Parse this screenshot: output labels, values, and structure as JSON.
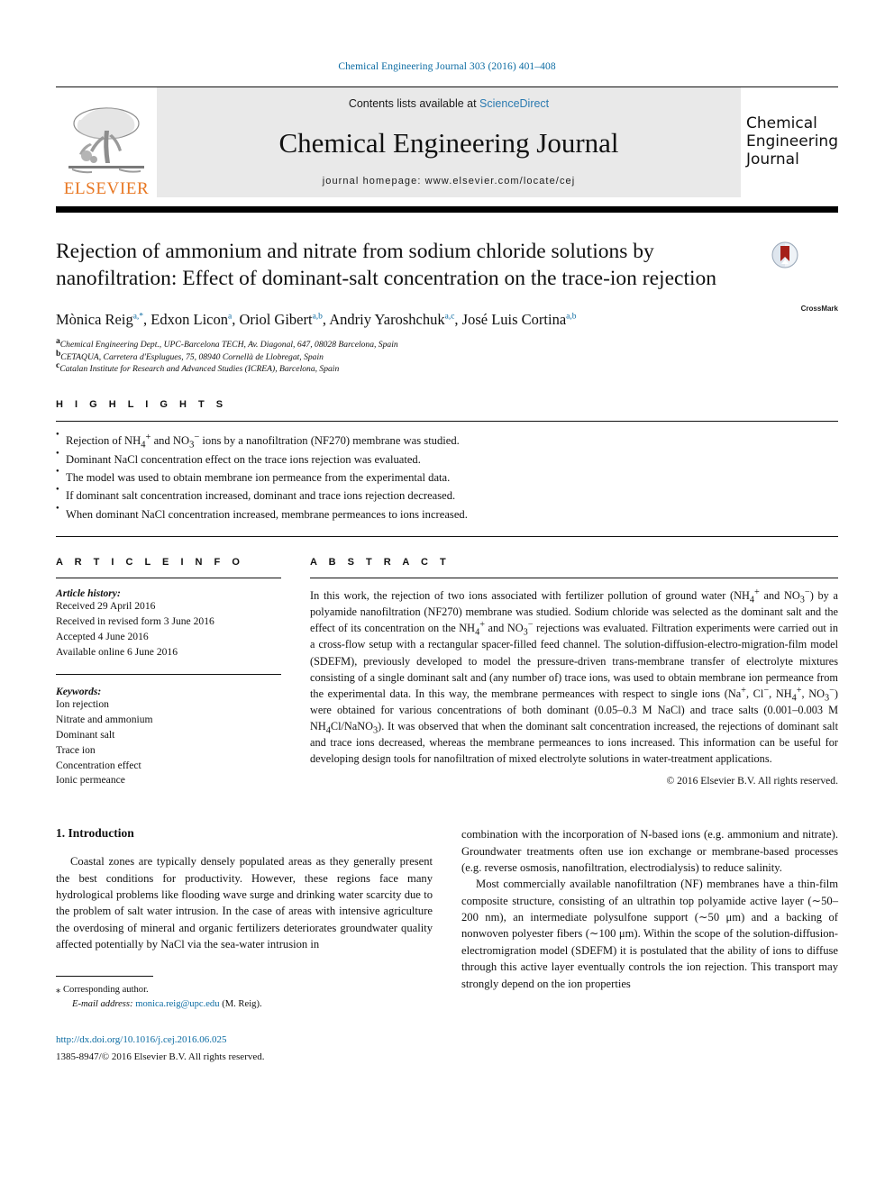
{
  "running_head": "Chemical Engineering Journal 303 (2016) 401–408",
  "masthead": {
    "publisher_name": "ELSEVIER",
    "contents_prefix": "Contents lists available at ",
    "contents_link": "ScienceDirect",
    "journal_title": "Chemical Engineering Journal",
    "homepage": "journal homepage: www.elsevier.com/locate/cej",
    "cover_line1": "Chemical",
    "cover_line2": "Engineering",
    "cover_line3": "Journal"
  },
  "article": {
    "title": "Rejection of ammonium and nitrate from sodium chloride solutions by nanofiltration: Effect of dominant-salt concentration on the trace-ion rejection",
    "crossmark_label": "CrossMark",
    "authors": [
      {
        "name": "Mònica Reig",
        "marks": "a,*"
      },
      {
        "name": "Edxon Licon",
        "marks": "a"
      },
      {
        "name": "Oriol Gibert",
        "marks": "a,b"
      },
      {
        "name": "Andriy Yaroshchuk",
        "marks": "a,c"
      },
      {
        "name": "José Luis Cortina",
        "marks": "a,b"
      }
    ],
    "affiliations": [
      {
        "mark": "a",
        "text": "Chemical Engineering Dept., UPC-Barcelona TECH, Av. Diagonal, 647, 08028 Barcelona, Spain"
      },
      {
        "mark": "b",
        "text": "CETAQUA, Carretera d'Esplugues, 75, 08940 Cornellà de Llobregat, Spain"
      },
      {
        "mark": "c",
        "text": "Catalan Institute for Research and Advanced Studies (ICREA), Barcelona, Spain"
      }
    ]
  },
  "highlights": {
    "heading": "H I G H L I G H T S",
    "items": [
      "Rejection of NH4+ and NO3− ions by a nanofiltration (NF270) membrane was studied.",
      "Dominant NaCl concentration effect on the trace ions rejection was evaluated.",
      "The model was used to obtain membrane ion permeance from the experimental data.",
      "If dominant salt concentration increased, dominant and trace ions rejection decreased.",
      "When dominant NaCl concentration increased, membrane permeances to ions increased."
    ]
  },
  "article_info": {
    "heading": "A R T I C L E   I N F O",
    "history_label": "Article history:",
    "history": [
      "Received 29 April 2016",
      "Received in revised form 3 June 2016",
      "Accepted 4 June 2016",
      "Available online 6 June 2016"
    ],
    "keywords_label": "Keywords:",
    "keywords": [
      "Ion rejection",
      "Nitrate and ammonium",
      "Dominant salt",
      "Trace ion",
      "Concentration effect",
      "Ionic permeance"
    ]
  },
  "abstract": {
    "heading": "A B S T R A C T",
    "text": "In this work, the rejection of two ions associated with fertilizer pollution of ground water (NH4+ and NO3−) by a polyamide nanofiltration (NF270) membrane was studied. Sodium chloride was selected as the dominant salt and the effect of its concentration on the NH4+ and NO3− rejections was evaluated. Filtration experiments were carried out in a cross-flow setup with a rectangular spacer-filled feed channel. The solution-diffusion-electro-migration-film model (SDEFM), previously developed to model the pressure-driven trans-membrane transfer of electrolyte mixtures consisting of a single dominant salt and (any number of) trace ions, was used to obtain membrane ion permeance from the experimental data. In this way, the membrane permeances with respect to single ions (Na+, Cl−, NH4+, NO3−) were obtained for various concentrations of both dominant (0.05–0.3 M NaCl) and trace salts (0.001–0.003 M NH4Cl/NaNO3). It was observed that when the dominant salt concentration increased, the rejections of dominant salt and trace ions decreased, whereas the membrane permeances to ions increased. This information can be useful for developing design tools for nanofiltration of mixed electrolyte solutions in water-treatment applications.",
    "copyright": "© 2016 Elsevier B.V. All rights reserved."
  },
  "introduction": {
    "heading": "1. Introduction",
    "left_paragraph": "Coastal zones are typically densely populated areas as they generally present the best conditions for productivity. However, these regions face many hydrological problems like flooding wave surge and drinking water scarcity due to the problem of salt water intrusion. In the case of areas with intensive agriculture the overdosing of mineral and organic fertilizers deteriorates groundwater quality affected potentially by NaCl via the sea-water intrusion in",
    "right_paragraph_1": "combination with the incorporation of N-based ions (e.g. ammonium and nitrate). Groundwater treatments often use ion exchange or membrane-based processes (e.g. reverse osmosis, nanofiltration, electrodialysis) to reduce salinity.",
    "right_paragraph_2": "Most commercially available nanofiltration (NF) membranes have a thin-film composite structure, consisting of an ultrathin top polyamide active layer (∼50–200 nm), an intermediate polysulfone support (∼50 μm) and a backing of nonwoven polyester fibers (∼100 μm). Within the scope of the solution-diffusion-electromigration model (SDEFM) it is postulated that the ability of ions to diffuse through this active layer eventually controls the ion rejection. This transport may strongly depend on the ion properties"
  },
  "footer": {
    "corresponding_marker": "⁎",
    "corresponding_text": "Corresponding author.",
    "email_label": "E-mail address:",
    "email": "monica.reig@upc.edu",
    "email_suffix": "(M. Reig).",
    "doi": "http://dx.doi.org/10.1016/j.cej.2016.06.025",
    "issn_line": "1385-8947/© 2016 Elsevier B.V. All rights reserved."
  },
  "colors": {
    "link": "#0b6ba2",
    "elsevier_orange": "#e87722",
    "masthead_gray": "#e9e9e9",
    "crossmark_red": "#a52019"
  }
}
